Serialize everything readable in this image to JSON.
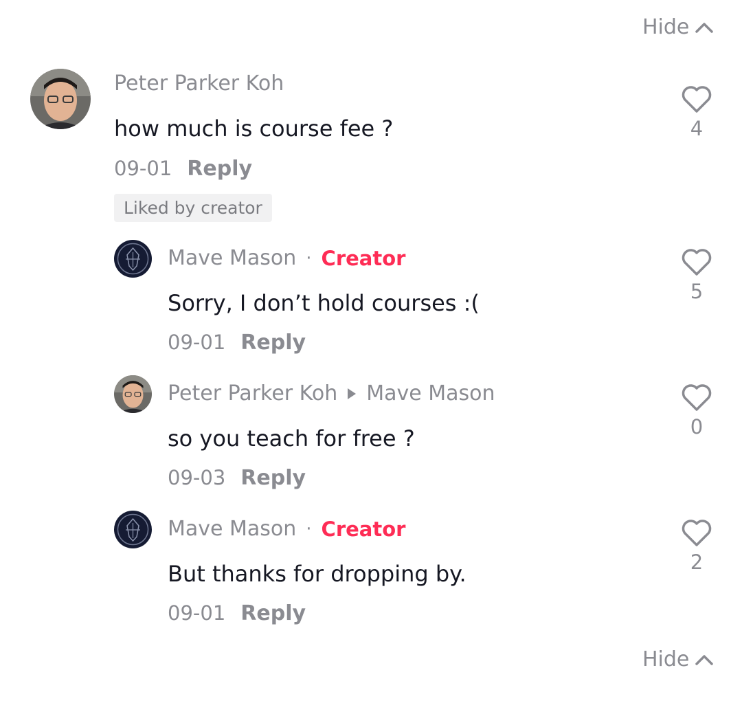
{
  "hide_label": "Hide",
  "comment": {
    "author": "Peter Parker Koh",
    "text": "how much is course fee ?",
    "date": "09-01",
    "reply_label": "Reply",
    "badge": "Liked by creator",
    "likes": "4"
  },
  "replies": [
    {
      "author": "Mave Mason",
      "separator": "·",
      "tag": "Creator",
      "text": "Sorry, I don’t hold courses :(",
      "date": "09-01",
      "reply_label": "Reply",
      "likes": "5"
    },
    {
      "author": "Peter Parker Koh",
      "reply_to": "Mave Mason",
      "text": "so you teach for free ?",
      "date": "09-03",
      "reply_label": "Reply",
      "likes": "0"
    },
    {
      "author": "Mave Mason",
      "separator": "·",
      "tag": "Creator",
      "text": "But thanks for dropping by.",
      "date": "09-01",
      "reply_label": "Reply",
      "likes": "2"
    }
  ],
  "colors": {
    "creator": "#fe2c55",
    "secondary_text": "#8a8b91",
    "primary_text": "#161823"
  },
  "icons": [
    "chevron-up-icon",
    "heart-outline-icon",
    "play-arrow-icon"
  ]
}
